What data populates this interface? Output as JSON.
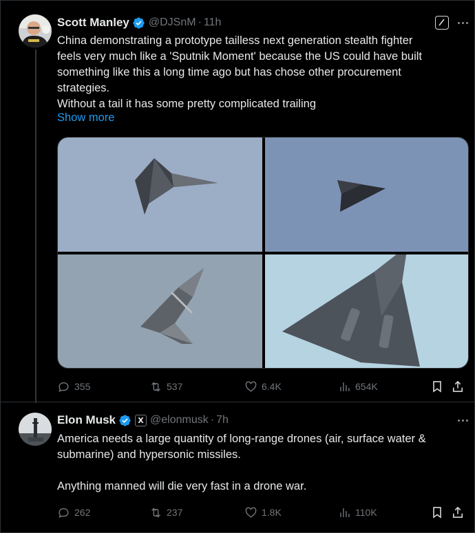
{
  "tweets": [
    {
      "name": "Scott Manley",
      "handle": "@DJSnM",
      "dot": "·",
      "time": "11h",
      "lines": [
        "China demonstrating a prototype tailless next generation stealth fighter",
        "feels very much like a 'Sputnik Moment' because the US could have built",
        "something like this a long time ago but has chose other procurement",
        "strategies.",
        "Without a tail it has some pretty complicated trailing"
      ],
      "show_more": "Show more",
      "stats": {
        "replies": "355",
        "reposts": "537",
        "likes": "6.4K",
        "views": "654K"
      }
    },
    {
      "name": "Elon Musk",
      "handle": "@elonmusk",
      "dot": "·",
      "time": "7h",
      "affiliate_badge": "X",
      "lines": [
        "America needs a large quantity of long-range drones (air, surface water &",
        "submarine) and hypersonic missiles.",
        "",
        "Anything manned will die very fast in a drone war."
      ],
      "stats": {
        "replies": "262",
        "reposts": "237",
        "likes": "1.8K",
        "views": "110K"
      }
    }
  ],
  "colors": {
    "accent": "#1d9bf0",
    "muted": "#71767b",
    "text": "#e7e9ea",
    "verified": "#1d9bf0"
  }
}
